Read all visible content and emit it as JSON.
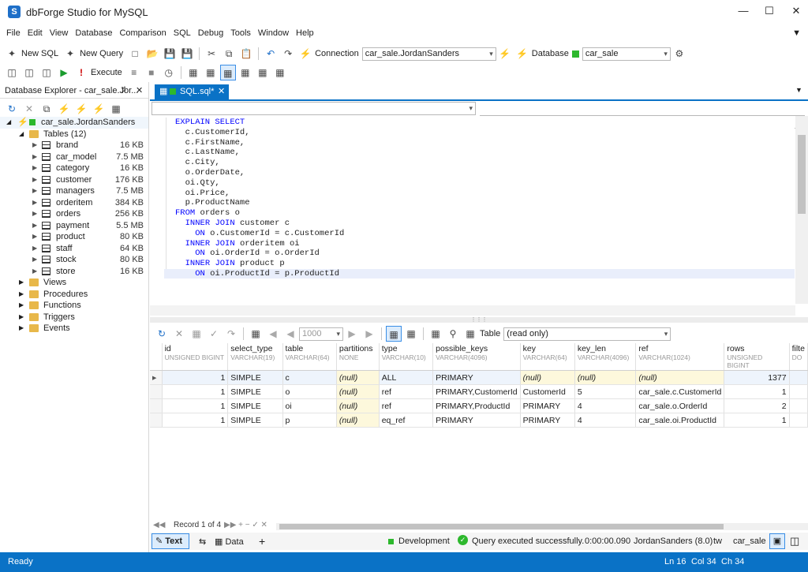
{
  "app": {
    "title": "dbForge Studio for MySQL",
    "logo": "S"
  },
  "menu": [
    "File",
    "Edit",
    "View",
    "Database",
    "Comparison",
    "SQL",
    "Debug",
    "Tools",
    "Window",
    "Help"
  ],
  "toolbar1": {
    "new_sql": "New SQL",
    "new_query": "New Query",
    "connection_label": "Connection",
    "connection_value": "car_sale.JordanSanders",
    "database_label": "Database",
    "database_value": "car_sale"
  },
  "toolbar2": {
    "execute": "Execute"
  },
  "explorer": {
    "title": "Database Explorer - car_sale.Jor...",
    "connection": "car_sale.JordanSanders",
    "tables_label": "Tables (12)",
    "tables": [
      {
        "name": "brand",
        "size": "16 KB"
      },
      {
        "name": "car_model",
        "size": "7.5 MB"
      },
      {
        "name": "category",
        "size": "16 KB"
      },
      {
        "name": "customer",
        "size": "176 KB"
      },
      {
        "name": "managers",
        "size": "7.5 MB"
      },
      {
        "name": "orderitem",
        "size": "384 KB"
      },
      {
        "name": "orders",
        "size": "256 KB"
      },
      {
        "name": "payment",
        "size": "5.5 MB"
      },
      {
        "name": "product",
        "size": "80 KB"
      },
      {
        "name": "staff",
        "size": "64 KB"
      },
      {
        "name": "stock",
        "size": "80 KB"
      },
      {
        "name": "store",
        "size": "16 KB"
      }
    ],
    "folders": [
      "Views",
      "Procedures",
      "Functions",
      "Triggers",
      "Events"
    ]
  },
  "tab": {
    "label": "SQL.sql*"
  },
  "code": [
    "EXPLAIN SELECT",
    "  c.CustomerId,",
    "  c.FirstName,",
    "  c.LastName,",
    "  c.City,",
    "  o.OrderDate,",
    "  oi.Qty,",
    "  oi.Price,",
    "  p.ProductName",
    "FROM orders o",
    "  INNER JOIN customer c",
    "    ON o.CustomerId = c.CustomerId",
    "  INNER JOIN orderitem oi",
    "    ON oi.OrderId = o.OrderId",
    "  INNER JOIN product p",
    "    ON oi.ProductId = p.ProductId"
  ],
  "grid_toolbar": {
    "page_size": "1000",
    "table_label": "Table",
    "table_mode": "(read only)"
  },
  "results": {
    "columns": [
      {
        "name": "id",
        "type": "UNSIGNED BIGINT"
      },
      {
        "name": "select_type",
        "type": "VARCHAR(19)"
      },
      {
        "name": "table",
        "type": "VARCHAR(64)"
      },
      {
        "name": "partitions",
        "type": "NONE"
      },
      {
        "name": "type",
        "type": "VARCHAR(10)"
      },
      {
        "name": "possible_keys",
        "type": "VARCHAR(4096)"
      },
      {
        "name": "key",
        "type": "VARCHAR(64)"
      },
      {
        "name": "key_len",
        "type": "VARCHAR(4096)"
      },
      {
        "name": "ref",
        "type": "VARCHAR(1024)"
      },
      {
        "name": "rows",
        "type": "UNSIGNED BIGINT"
      },
      {
        "name": "filte",
        "type": "DO"
      }
    ],
    "rows": [
      [
        "1",
        "SIMPLE",
        "c",
        "(null)",
        "ALL",
        "PRIMARY",
        "(null)",
        "(null)",
        "(null)",
        "1377"
      ],
      [
        "1",
        "SIMPLE",
        "o",
        "(null)",
        "ref",
        "PRIMARY,CustomerId",
        "CustomerId",
        "5",
        "car_sale.c.CustomerId",
        "1"
      ],
      [
        "1",
        "SIMPLE",
        "oi",
        "(null)",
        "ref",
        "PRIMARY,ProductId",
        "PRIMARY",
        "4",
        "car_sale.o.OrderId",
        "2"
      ],
      [
        "1",
        "SIMPLE",
        "p",
        "(null)",
        "eq_ref",
        "PRIMARY",
        "PRIMARY",
        "4",
        "car_sale.oi.ProductId",
        "1"
      ]
    ]
  },
  "record_nav": "Record 1 of 4",
  "bottom": {
    "text_tab": "Text",
    "data_tab": "Data",
    "environment": "Development",
    "status": "Query executed successfully.",
    "time": "0:00:00.090",
    "user": "JordanSanders (8.0)",
    "tw": "tw",
    "db": "car_sale"
  },
  "statusbar": {
    "ready": "Ready",
    "ln": "Ln 16",
    "col": "Col 34",
    "ch": "Ch 34"
  }
}
